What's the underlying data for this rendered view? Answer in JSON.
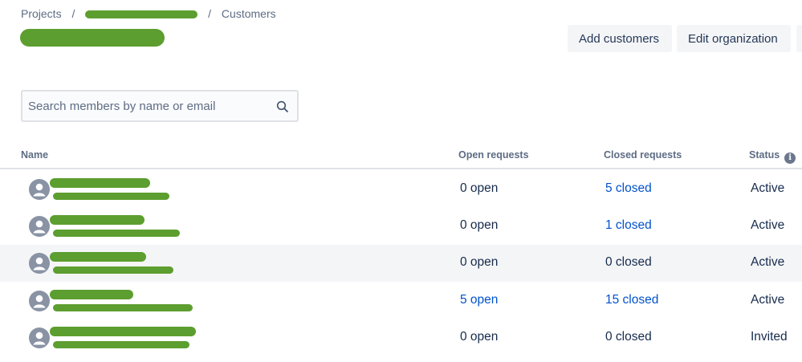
{
  "breadcrumb": {
    "items": [
      "Projects",
      "Customers"
    ],
    "separator": "/"
  },
  "header": {
    "add_customers_label": "Add customers",
    "edit_organization_label": "Edit organization"
  },
  "search": {
    "placeholder": "Search members by name or email"
  },
  "table": {
    "columns": {
      "name": "Name",
      "open_requests": "Open requests",
      "closed_requests": "Closed requests",
      "status": "Status"
    },
    "rows": [
      {
        "open": "0 open",
        "open_link": false,
        "closed": "5 closed",
        "closed_link": true,
        "status": "Active"
      },
      {
        "open": "0 open",
        "open_link": false,
        "closed": "1 closed",
        "closed_link": true,
        "status": "Active"
      },
      {
        "open": "0 open",
        "open_link": false,
        "closed": "0 closed",
        "closed_link": false,
        "status": "Active"
      },
      {
        "open": "5 open",
        "open_link": true,
        "closed": "15 closed",
        "closed_link": true,
        "status": "Active"
      },
      {
        "open": "0 open",
        "open_link": false,
        "closed": "0 closed",
        "closed_link": false,
        "status": "Invited"
      }
    ]
  },
  "colors": {
    "link": "#0052cc",
    "text": "#172b4d",
    "muted": "#5e6c84",
    "redaction": "#5c9e2f",
    "row_shade": "#f4f5f7"
  }
}
